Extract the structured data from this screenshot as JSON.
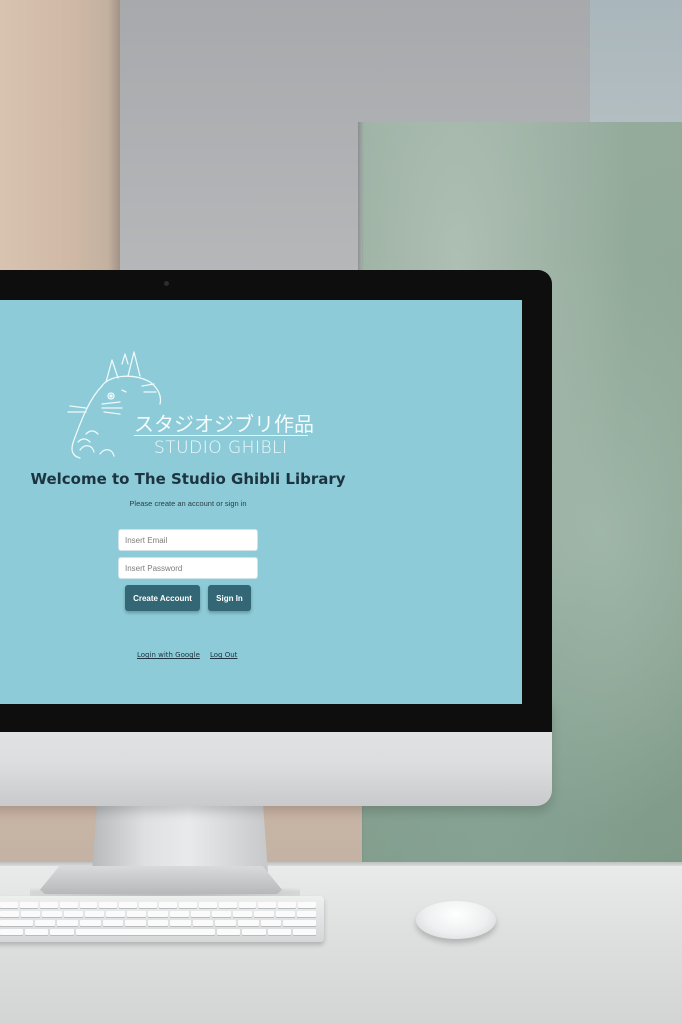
{
  "app": {
    "logo": {
      "japanese_text": "スタジオジブリ作品",
      "english_text": "STUDIO GHIBLI",
      "mascot_icon": "totoro-icon"
    },
    "welcome_title": "Welcome to The Studio Ghibli Library",
    "subtitle": "Please create an account or sign in",
    "form": {
      "email_placeholder": "Insert Email",
      "email_value": "",
      "password_placeholder": "Insert Password",
      "password_value": ""
    },
    "buttons": {
      "create_account": "Create Account",
      "sign_in": "Sign In"
    },
    "links": {
      "google_login": "Login with Google",
      "log_out": "Log Out"
    }
  },
  "colors": {
    "screen_background": "#8ccbd7",
    "button_background": "#336776",
    "title_text": "#1c3340"
  }
}
